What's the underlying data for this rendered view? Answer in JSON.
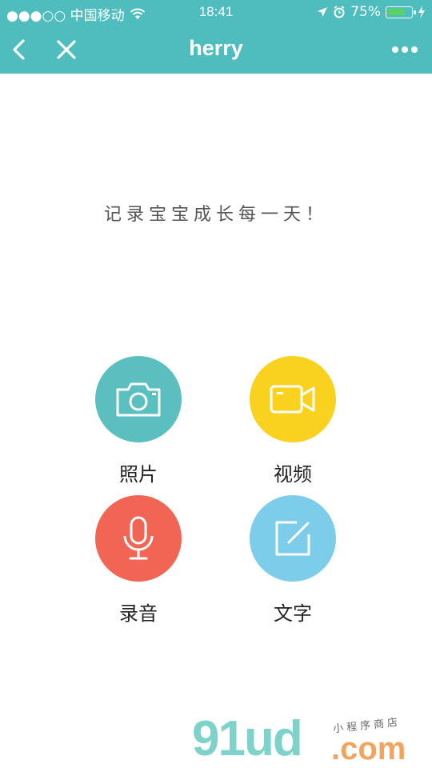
{
  "status_bar": {
    "carrier": "●●●○○ 中国移动",
    "time": "18:41",
    "battery_percent": "75%",
    "battery_level": 0.75,
    "battery_color": "#59d45d"
  },
  "nav": {
    "title": "herry",
    "background": "#4fbcbe",
    "back_icon": "back-chevron-icon",
    "close_icon": "close-icon",
    "more_icon": "more-dots-icon"
  },
  "slogan": "记录宝宝成长每一天！",
  "actions": [
    {
      "label": "照片",
      "icon": "camera-icon",
      "color": "#5bbfbf"
    },
    {
      "label": "视频",
      "icon": "video-camera-icon",
      "color": "#fbd11f"
    },
    {
      "label": "录音",
      "icon": "microphone-icon",
      "color": "#f06553"
    },
    {
      "label": "文字",
      "icon": "edit-note-icon",
      "color": "#7cccea"
    }
  ],
  "watermark": {
    "brand": "91ud",
    "domain": ".com",
    "tagline": "小程序商店"
  }
}
